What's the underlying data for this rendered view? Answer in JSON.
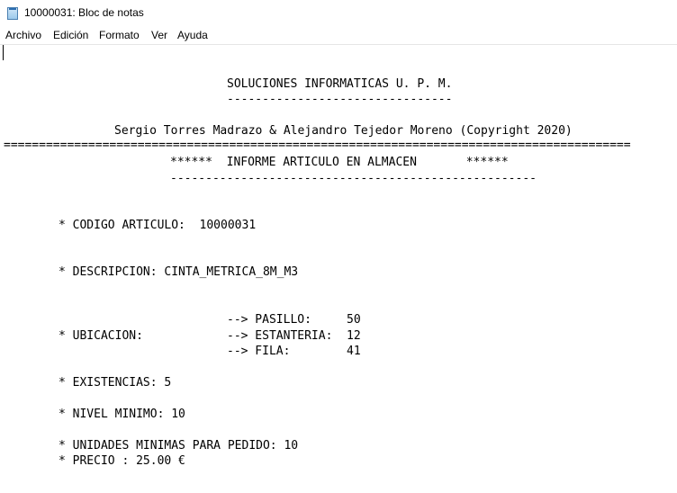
{
  "window": {
    "title": "10000031: Bloc de notas",
    "icon": "notepad-icon"
  },
  "menu": {
    "items": [
      "Archivo",
      "Edición",
      "Formato",
      "Ver",
      "Ayuda"
    ]
  },
  "document": {
    "company": "SOLUCIONES INFORMATICAS U. P. M.",
    "company_underline": "--------------------------------",
    "authors": "Sergio Torres Madrazo & Alejandro Tejedor Moreno (Copyright 2020)",
    "separator": "=========================================================================================",
    "report_title": "******  INFORME ARTICULO EN ALMACEN       ******",
    "report_underline": "----------------------------------------------------",
    "codigo": "* CODIGO ARTICULO:  10000031",
    "descripcion": "* DESCRIPCION: CINTA_METRICA_8M_M3",
    "ubicacion_label": "* UBICACION:",
    "pasillo": "--> PASILLO:     50",
    "estanteria": "--> ESTANTERIA:  12",
    "fila": "--> FILA:        41",
    "existencias": "* EXISTENCIAS: 5",
    "nivel_minimo": "* NIVEL MINIMO: 10",
    "unidades_minimas": "* UNIDADES MINIMAS PARA PEDIDO: 10",
    "precio": "* PRECIO : 25.00 €"
  }
}
